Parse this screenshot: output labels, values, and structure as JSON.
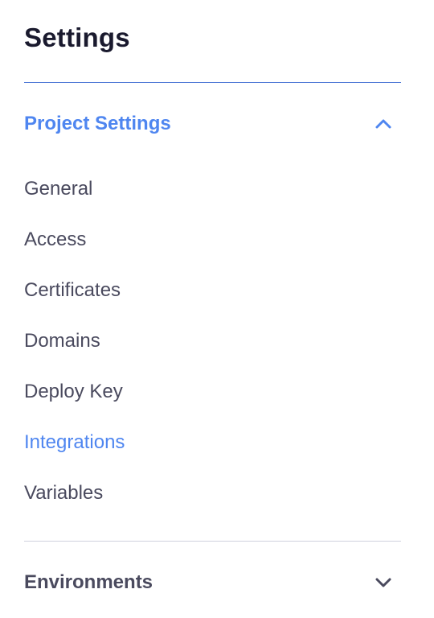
{
  "header": {
    "title": "Settings"
  },
  "project_settings": {
    "label": "Project Settings",
    "expanded": true,
    "chevron_icon": "chevron-up-icon",
    "accent_color": "#4f86f0",
    "items": [
      {
        "label": "General",
        "active": false
      },
      {
        "label": "Access",
        "active": false
      },
      {
        "label": "Certificates",
        "active": false
      },
      {
        "label": "Domains",
        "active": false
      },
      {
        "label": "Deploy Key",
        "active": false
      },
      {
        "label": "Integrations",
        "active": true
      },
      {
        "label": "Variables",
        "active": false
      }
    ]
  },
  "environments": {
    "label": "Environments",
    "expanded": false,
    "chevron_icon": "chevron-down-icon"
  }
}
